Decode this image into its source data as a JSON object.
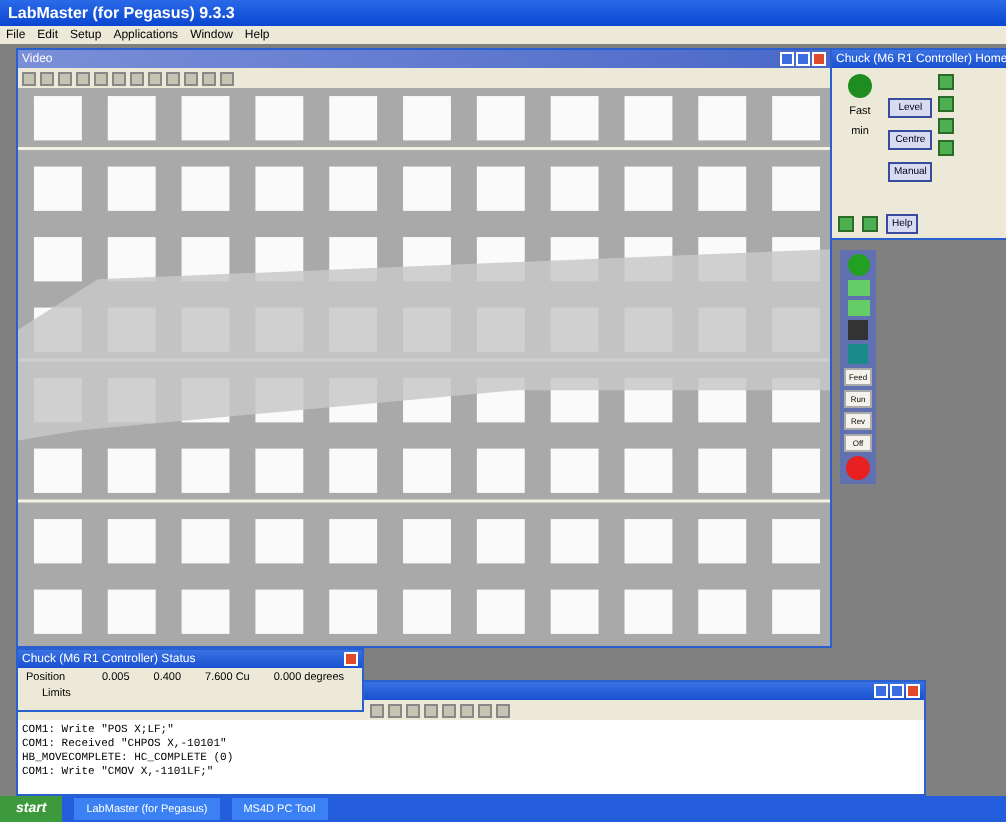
{
  "app": {
    "title": "LabMaster (for Pegasus) 9.3.3"
  },
  "menu": [
    "File",
    "Edit",
    "Setup",
    "Applications",
    "Window",
    "Help"
  ],
  "video": {
    "title": "Video"
  },
  "controller": {
    "title": "Chuck (M6 R1 Controller) Home",
    "speed": "Fast",
    "unit": "min",
    "buttons": [
      "Level",
      "Centre",
      "Manual"
    ],
    "help": "Help"
  },
  "side_panel": {
    "text_buttons": [
      "Feed",
      "Run",
      "Rev",
      "Off"
    ]
  },
  "status": {
    "title": "Chuck (M6 R1 Controller) Status",
    "row_label": "Position",
    "values": [
      "0.005",
      "0.400",
      "7.600 Cu",
      "0.000 degrees"
    ],
    "limits": "Limits"
  },
  "log": {
    "lines": [
      "COM1: Write \"POS X;LF;\"",
      "COM1: Received \"CHPOS X,-10101\"",
      "HB_MOVECOMPLETE: HC_COMPLETE (0)",
      "COM1: Write \"CMOV X,-1101LF;\""
    ]
  },
  "taskbar": {
    "start": "start",
    "tasks": [
      "LabMaster (for Pegasus)",
      "MS4D PC Tool"
    ]
  }
}
